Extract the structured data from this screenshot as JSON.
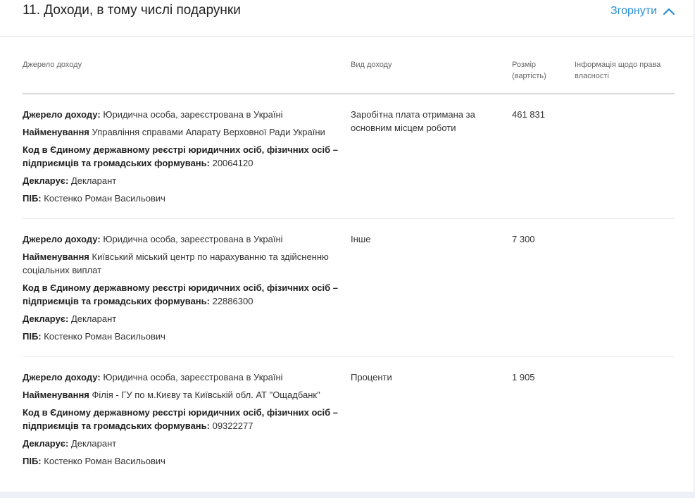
{
  "section": {
    "title": "11. Доходи, в тому числі подарунки",
    "collapse_label": "Згорнути"
  },
  "table": {
    "headers": {
      "source": "Джерело доходу",
      "type": "Вид доходу",
      "amount": "Розмір (вартість)",
      "ownership": "Інформація щодо права власності"
    },
    "field_labels": {
      "source": "Джерело доходу:",
      "name": "Найменування",
      "code": "Код в Єдиному державному реєстрі юридичних осіб, фізичних осіб – підприємців та громадських формувань:",
      "declarant": "Декларує:",
      "fullname": "ПІБ:"
    },
    "rows": [
      {
        "source": "Юридична особа, зареєстрована в Україні",
        "name": "Управління справами Апарату Верховної Ради України",
        "code": "20064120",
        "declarant": "Декларант",
        "fullname": "Костенко Роман Васильович",
        "type": "Заробітна плата отримана за основним місцем роботи",
        "amount": "461 831",
        "ownership": ""
      },
      {
        "source": "Юридична особа, зареєстрована в Україні",
        "name": "Київський міський центр по нарахуванню та здійсненню соціальних виплат",
        "code": "22886300",
        "declarant": "Декларант",
        "fullname": "Костенко Роман Васильович",
        "type": "Інше",
        "amount": "7 300",
        "ownership": ""
      },
      {
        "source": "Юридична особа, зареєстрована в Україні",
        "name": "Філія - ГУ по м.Києву та Київській обл. АТ \"Ощадбанк\"",
        "code": "09322277",
        "declarant": "Декларант",
        "fullname": "Костенко Роман Васильович",
        "type": "Проценти",
        "amount": "1 905",
        "ownership": ""
      }
    ]
  },
  "colors": {
    "accent": "#2a8fd0",
    "border": "#e8e8e8",
    "header_text": "#666666"
  },
  "icons": {
    "collapse": "chevron-up-icon"
  }
}
